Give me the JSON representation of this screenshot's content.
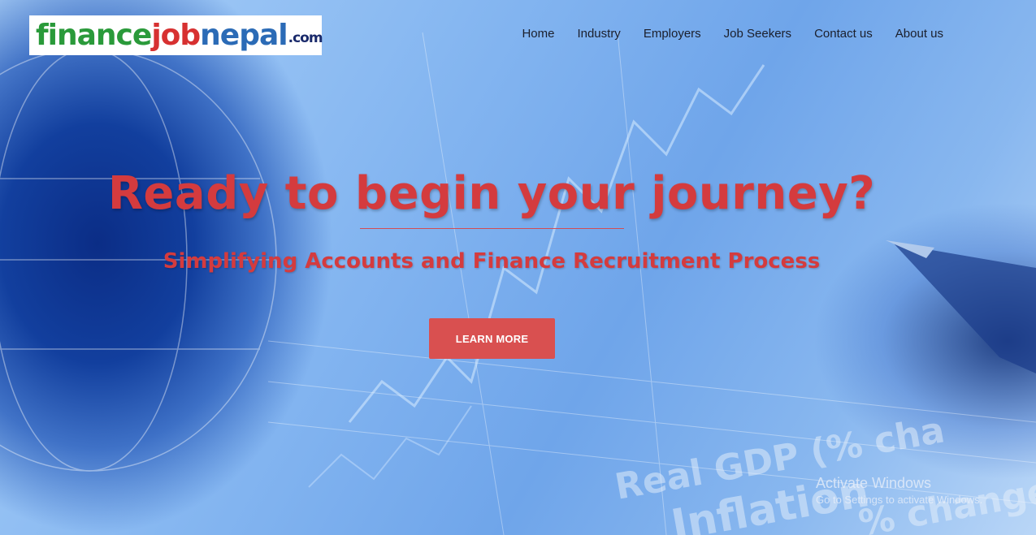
{
  "logo": {
    "part1": "finance",
    "part2": "job",
    "part3": "nepal",
    "part4": ".com"
  },
  "nav": {
    "home": "Home",
    "industry": "Industry",
    "employers": "Employers",
    "job_seekers": "Job Seekers",
    "contact": "Contact us",
    "about": "About us"
  },
  "hero": {
    "headline": "Ready to begin your journey?",
    "subheadline": "Simplifying Accounts and Finance Recruitment Process",
    "cta_label": "LEARN MORE"
  },
  "background_text": {
    "line1": "Real GDP (% cha",
    "line2": "Inflation",
    "line3": "% change"
  },
  "watermark": {
    "title": "Activate Windows",
    "subtitle": "Go to Settings to activate Windows."
  },
  "colors": {
    "accent_red": "#d43b3e",
    "button_red": "#d95050",
    "logo_green": "#2a9a3a",
    "logo_blue": "#2b6bb6"
  }
}
